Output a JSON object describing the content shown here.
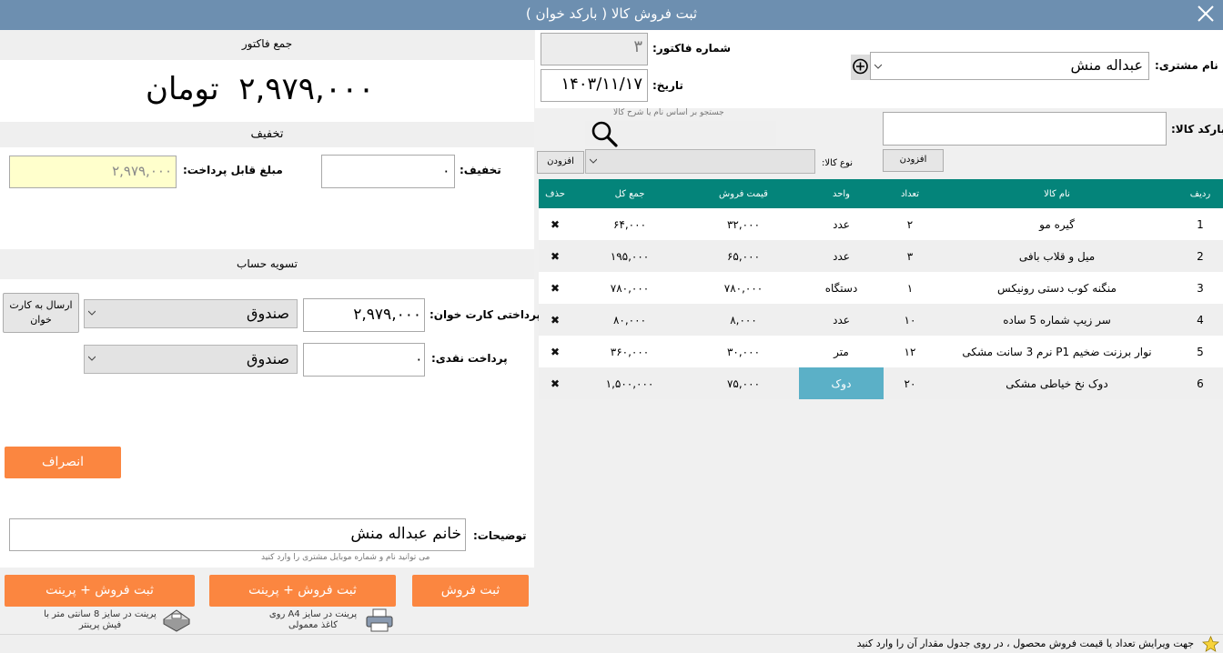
{
  "window": {
    "title": "ثبت فروش کالا ( بارکد خوان )"
  },
  "invoice_total": {
    "header": "جمع فاکتور",
    "amount": "۲,۹۷۹,۰۰۰",
    "currency": "تومان"
  },
  "discount": {
    "header": "تخفیف",
    "discount_label": "تخفیف:",
    "discount_value": "۰",
    "payable_label": "مبلغ قابل پرداخت:",
    "payable_value": "۲,۹۷۹,۰۰۰"
  },
  "settlement": {
    "header": "تسویه حساب",
    "card_label": "پرداختی کارت خوان:",
    "card_value": "۲,۹۷۹,۰۰۰",
    "card_account": "صندوق",
    "send_card_label": "ارسال به کارت خوان",
    "cash_label": "پرداخت نقدی:",
    "cash_value": "۰",
    "cash_account": "صندوق"
  },
  "cancel_label": "انصراف",
  "notes": {
    "label": "توضیحات:",
    "value": "خانم عبداله منش",
    "hint": "می توانید نام و شماره موبایل مشتری را وارد کنید"
  },
  "actions": {
    "save_label": "ثبت فروش",
    "save_print_a4_label": "ثبت فروش + پرینت",
    "a4_note": "پرینت در سایز A4 روی کاغذ معمولی",
    "save_print_8cm_label": "ثبت فروش + پرینت",
    "note_8cm": "پرینت در سایز 8 سانتی متر با فیش پرینتر"
  },
  "customer": {
    "label": "نام مشتری:",
    "value": "عبداله منش"
  },
  "invoice": {
    "number_label": "شماره فاکتور:",
    "number_value": "۳",
    "date_label": "تاریخ:",
    "date_value": "۱۴۰۳/۱۱/۱۷"
  },
  "barcode": {
    "label": "بارکد کالا:",
    "value": "",
    "add_label": "افزودن"
  },
  "search": {
    "hint": "جستجو بر اساس نام یا شرح کالا"
  },
  "product_type": {
    "label": "نوع کالا:",
    "add_label": "افزودن"
  },
  "table": {
    "headers": [
      "ردیف",
      "نام کالا",
      "تعداد",
      "واحد",
      "قیمت فروش",
      "جمع کل",
      "حذف"
    ],
    "rows": [
      {
        "row": "1",
        "name": "گیره مو",
        "qty": "۲",
        "unit": "عدد",
        "price": "۳۲,۰۰۰",
        "total": "۶۴,۰۰۰"
      },
      {
        "row": "2",
        "name": "میل و قلاب بافی",
        "qty": "۳",
        "unit": "عدد",
        "price": "۶۵,۰۰۰",
        "total": "۱۹۵,۰۰۰"
      },
      {
        "row": "3",
        "name": "منگنه کوب دستی رونیکس",
        "qty": "۱",
        "unit": "دستگاه",
        "price": "۷۸۰,۰۰۰",
        "total": "۷۸۰,۰۰۰"
      },
      {
        "row": "4",
        "name": "سر زیپ شماره 5 ساده",
        "qty": "۱۰",
        "unit": "عدد",
        "price": "۸,۰۰۰",
        "total": "۸۰,۰۰۰"
      },
      {
        "row": "5",
        "name": "نوار برزنت ضخیم P1 نرم 3 سانت مشکی",
        "qty": "۱۲",
        "unit": "متر",
        "price": "۳۰,۰۰۰",
        "total": "۳۶۰,۰۰۰"
      },
      {
        "row": "6",
        "name": "دوک نخ خیاطی مشکی",
        "qty": "۲۰",
        "unit": "دوک",
        "price": "۷۵,۰۰۰",
        "total": "۱,۵۰۰,۰۰۰"
      }
    ]
  },
  "footer": {
    "tip": "جهت ویرایش تعداد یا قیمت فروش محصول ، در روی جدول مقدار آن را وارد کنید"
  },
  "colors": {
    "titlebar": "#6d8fb0",
    "accent_orange": "#fb8640",
    "grid_header": "#04847a",
    "unit_highlight": "#5bb0c7",
    "payable_bg": "#ffffcc"
  }
}
